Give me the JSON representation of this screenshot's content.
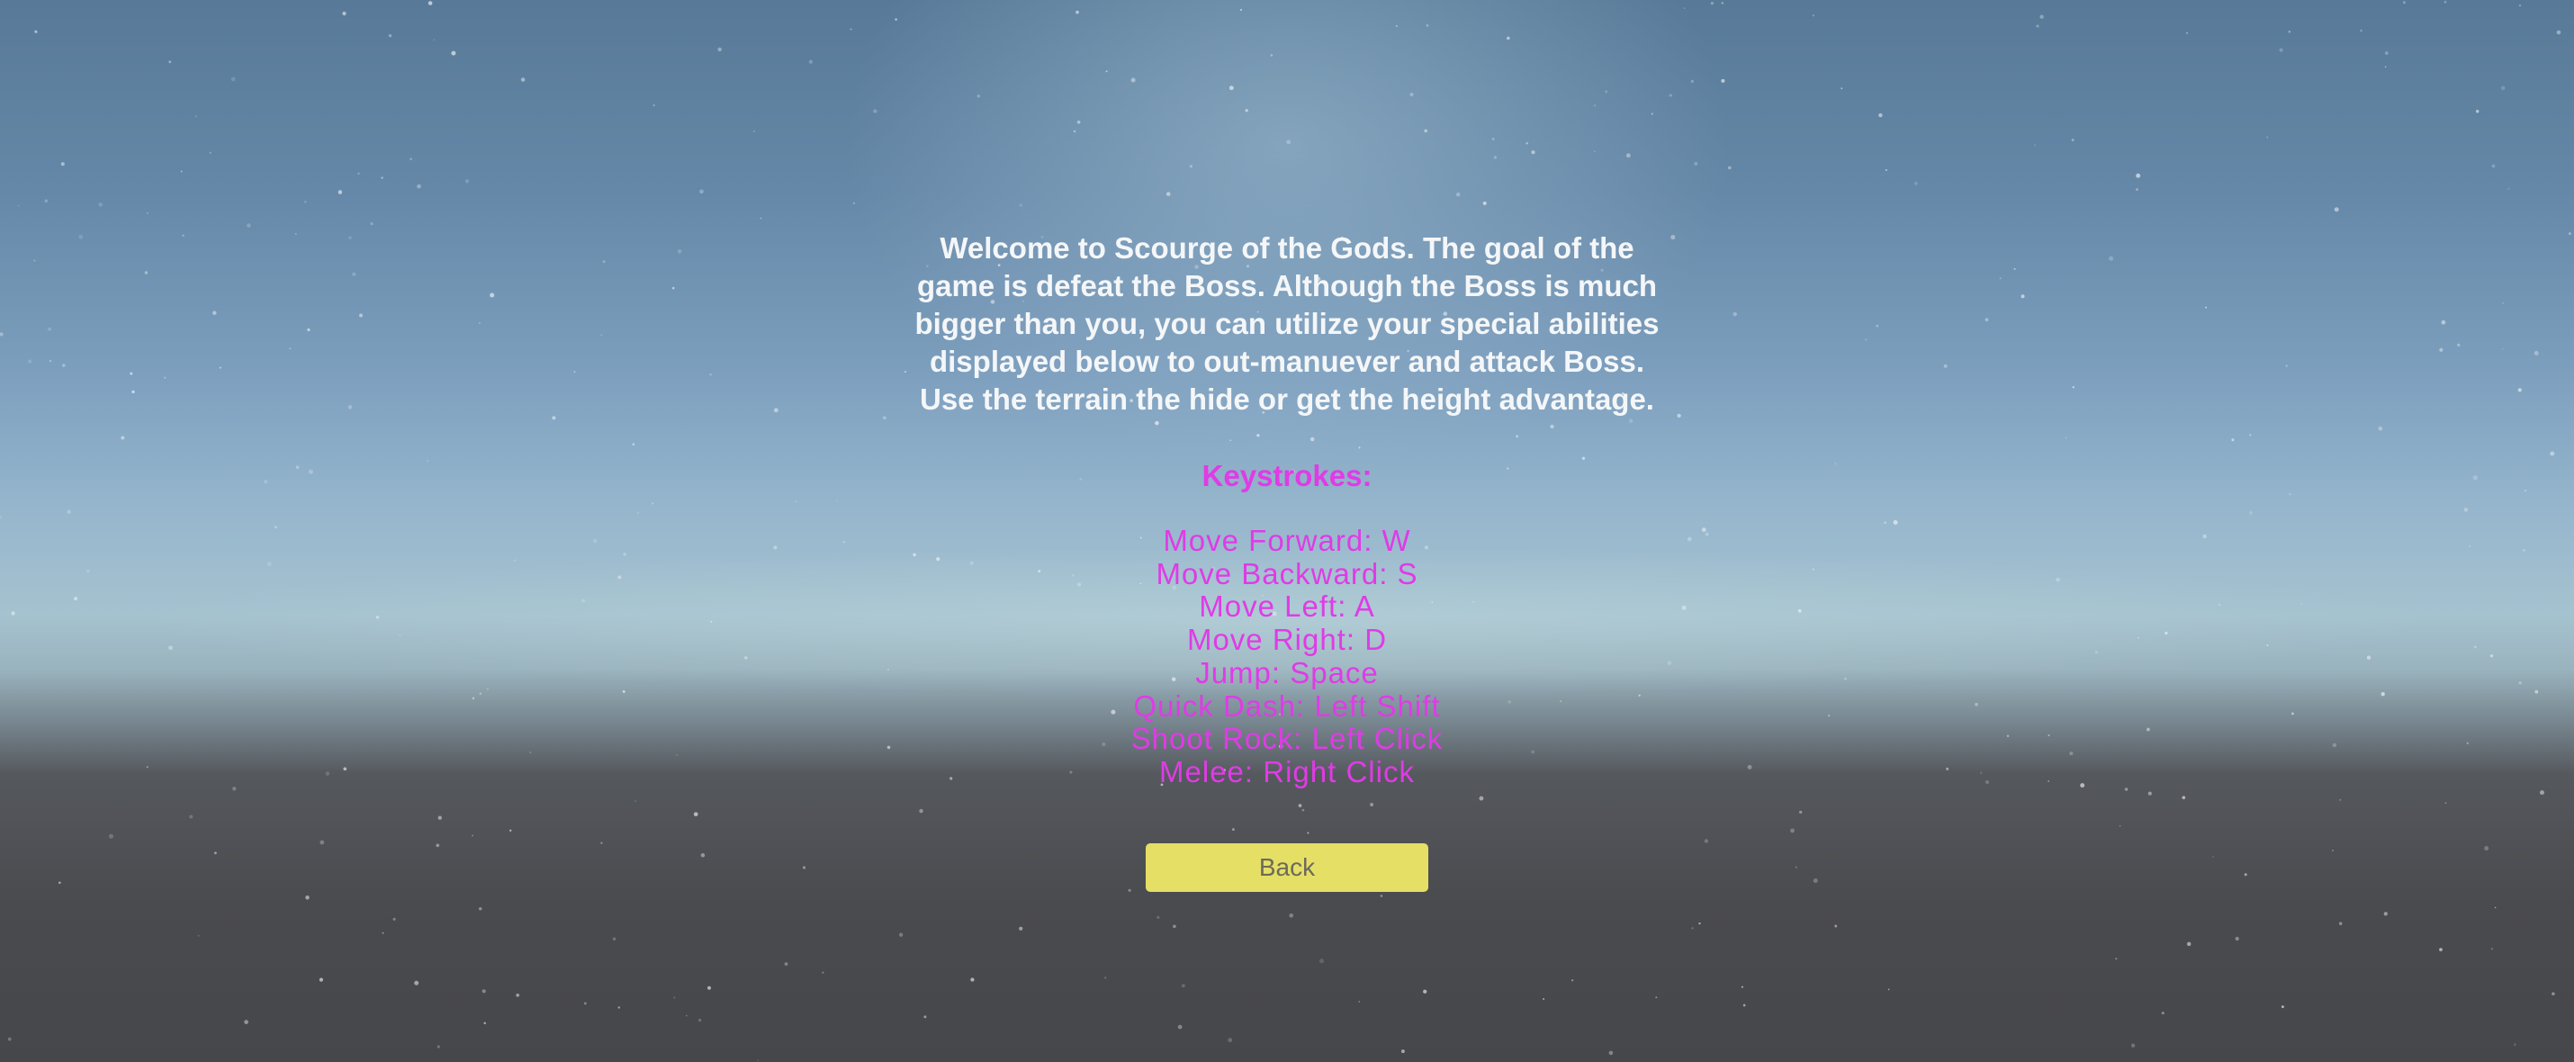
{
  "intro_text": "Welcome to Scourge of the Gods. The goal of the\ngame is defeat the Boss. Although the Boss is much\nbigger than you, you can utilize your special abilities\ndisplayed below to out-manuever and attack Boss.\nUse the terrain the hide or get the height advantage.",
  "keystrokes": {
    "heading": "Keystrokes:",
    "items": [
      "Move Forward: W",
      "Move Backward: S",
      "Move Left: A",
      "Move Right: D",
      "Jump: Space",
      "Quick Dash: Left Shift",
      "Shoot Rock: Left Click",
      "Melee: Right Click"
    ]
  },
  "back_button_label": "Back",
  "colors": {
    "intro_text": "#f4f6f8",
    "keystrokes_text": "#e03be6",
    "back_button": "#e5df66",
    "back_button_text": "#6e6a5a"
  }
}
